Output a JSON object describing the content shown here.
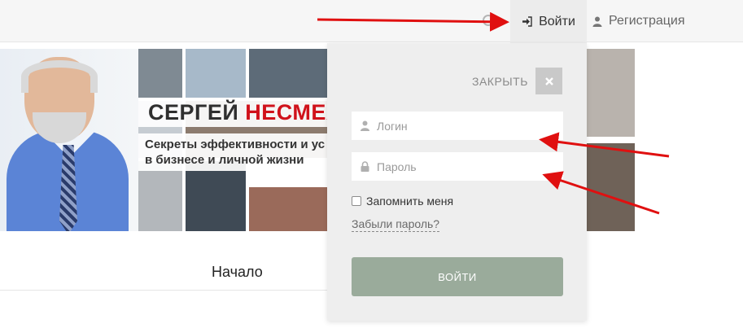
{
  "header": {
    "login_label": "Войти",
    "register_label": "Регистрация"
  },
  "banner": {
    "title_first": "СЕРГЕЙ",
    "title_accent": "НЕСМЕЯ",
    "subtitle_line1": "Секреты эффективности и ус",
    "subtitle_line2": "в бизнесе и личной жизни"
  },
  "nav": {
    "start_label": "Начало"
  },
  "login_panel": {
    "close_label": "ЗАКРЫТЬ",
    "username_placeholder": "Логин",
    "password_placeholder": "Пароль",
    "remember_label": "Запомнить меня",
    "forgot_label": "Забыли пароль?",
    "submit_label": "ВОЙТИ"
  },
  "colors": {
    "accent_red": "#d0121b",
    "submit_bg": "#9aab9b",
    "panel_bg": "#eeeeee",
    "annotation_arrow": "#e01010"
  }
}
